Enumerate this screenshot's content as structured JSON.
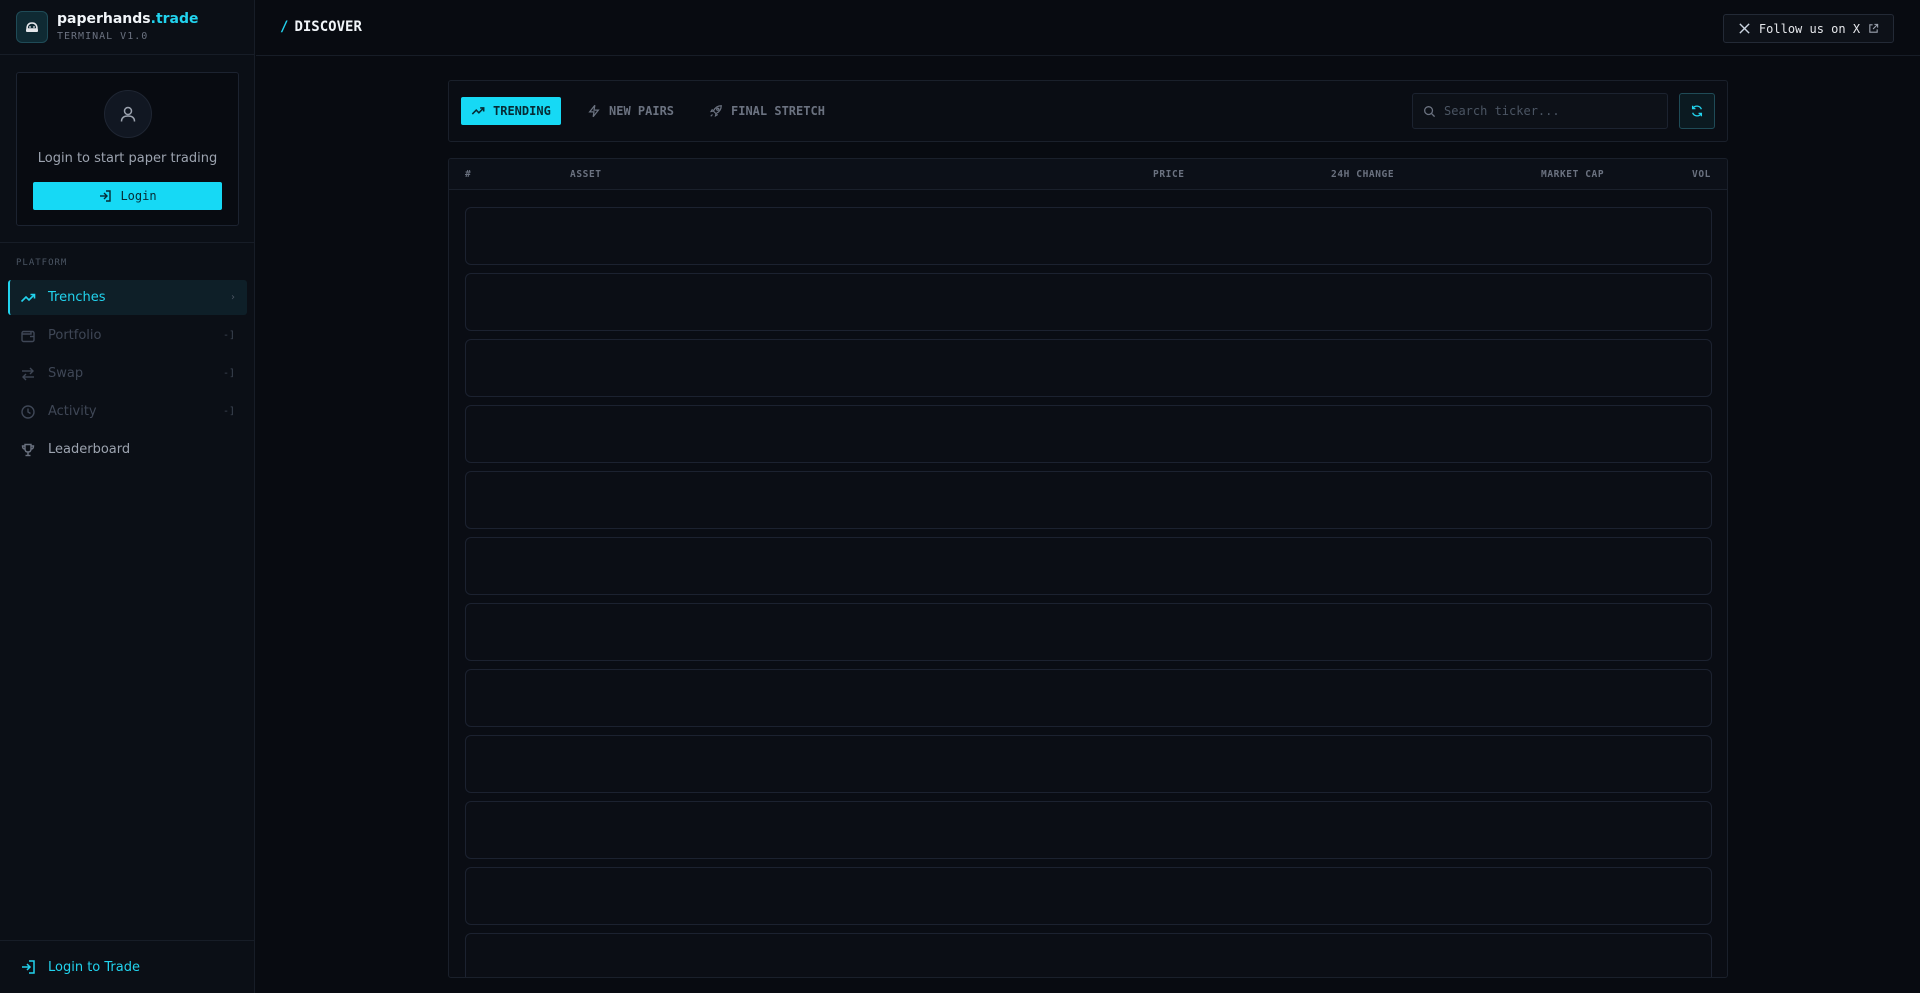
{
  "brand": {
    "name_main": "paperhands",
    "name_accent": ".trade",
    "subtitle": "TERMINAL V1.0"
  },
  "sidebar": {
    "login_card": {
      "text": "Login to start paper trading",
      "button_label": "Login"
    },
    "section_label": "PLATFORM",
    "items": [
      {
        "label": "Trenches",
        "icon": "trending-up-icon",
        "state": "active",
        "trail": "›"
      },
      {
        "label": "Portfolio",
        "icon": "wallet-icon",
        "state": "disabled",
        "trail": "-]"
      },
      {
        "label": "Swap",
        "icon": "swap-icon",
        "state": "disabled",
        "trail": "-]"
      },
      {
        "label": "Activity",
        "icon": "clock-icon",
        "state": "disabled",
        "trail": "-]"
      },
      {
        "label": "Leaderboard",
        "icon": "trophy-icon",
        "state": "normal",
        "trail": ""
      }
    ],
    "bottom_label": "Login to Trade"
  },
  "header": {
    "slash": "/",
    "title": "DISCOVER",
    "follow_label": "Follow us on X"
  },
  "toolbar": {
    "tabs": [
      {
        "label": "TRENDING",
        "icon": "trending-up-icon",
        "active": true
      },
      {
        "label": "NEW PAIRS",
        "icon": "lightning-icon",
        "active": false
      },
      {
        "label": "FINAL STRETCH",
        "icon": "rocket-icon",
        "active": false
      }
    ],
    "search_placeholder": "Search ticker..."
  },
  "table": {
    "columns": [
      "#",
      "ASSET",
      "PRICE",
      "24H CHANGE",
      "MARKET CAP",
      "VOL"
    ],
    "loading_rows": 12
  },
  "colors": {
    "accent": "#16d9f5",
    "background": "#080b11",
    "panel": "#0a0d14",
    "border": "#1a202b"
  }
}
